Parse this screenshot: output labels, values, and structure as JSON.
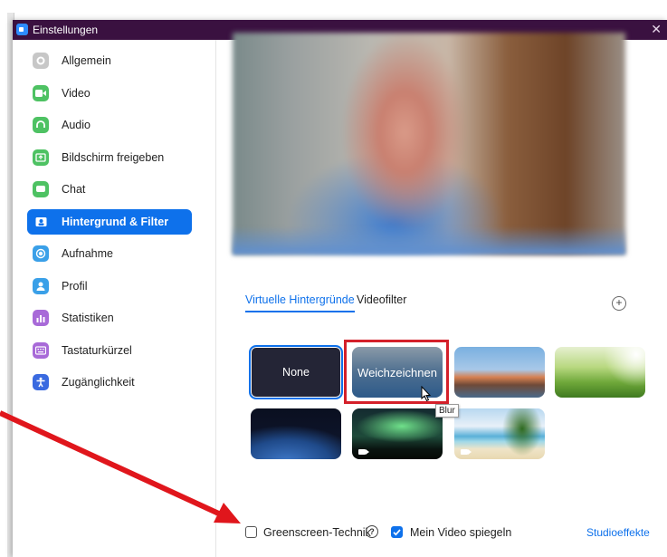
{
  "window": {
    "title": "Einstellungen",
    "close_glyph": "✕"
  },
  "sidebar": {
    "items": [
      {
        "label": "Allgemein",
        "icon": "gear-icon",
        "color": "#c7c7c7"
      },
      {
        "label": "Video",
        "icon": "video-camera-icon",
        "color": "#4ec263"
      },
      {
        "label": "Audio",
        "icon": "headphones-icon",
        "color": "#4ec263"
      },
      {
        "label": "Bildschirm freigeben",
        "icon": "share-screen-icon",
        "color": "#4ec263"
      },
      {
        "label": "Chat",
        "icon": "chat-bubble-icon",
        "color": "#4ec263"
      },
      {
        "label": "Hintergrund & Filter",
        "icon": "background-icon",
        "color": "#0e71eb",
        "active": true
      },
      {
        "label": "Aufnahme",
        "icon": "record-icon",
        "color": "#3aa0e8"
      },
      {
        "label": "Profil",
        "icon": "profile-icon",
        "color": "#3aa0e8"
      },
      {
        "label": "Statistiken",
        "icon": "statistics-icon",
        "color": "#a86ad8"
      },
      {
        "label": "Tastaturkürzel",
        "icon": "keyboard-icon",
        "color": "#a86ad8"
      },
      {
        "label": "Zugänglichkeit",
        "icon": "accessibility-icon",
        "color": "#3a6ae0"
      }
    ]
  },
  "main": {
    "tabs": [
      {
        "label": "Virtuelle Hintergründe",
        "active": true
      },
      {
        "label": "Videofilter",
        "active": false
      }
    ],
    "add_label": "+",
    "backgrounds": [
      {
        "label": "None",
        "kind": "none",
        "selected": true
      },
      {
        "label": "Weichzeichnen",
        "kind": "blur"
      },
      {
        "label": "",
        "kind": "golden-gate-bridge"
      },
      {
        "label": "",
        "kind": "grass"
      },
      {
        "label": "",
        "kind": "earth-from-space"
      },
      {
        "label": "",
        "kind": "northern-lights",
        "video": true
      },
      {
        "label": "",
        "kind": "beach",
        "video": true
      }
    ],
    "tooltip": "Blur",
    "greenscreen": {
      "label": "Greenscreen-Technik",
      "checked": false,
      "help": "?"
    },
    "mirror": {
      "label": "Mein Video spiegeln",
      "checked": true
    },
    "studio_effects": "Studioeffekte"
  },
  "colors": {
    "accent": "#0e71eb",
    "titlebar": "#3a1140",
    "annotation": "#d4202a"
  }
}
